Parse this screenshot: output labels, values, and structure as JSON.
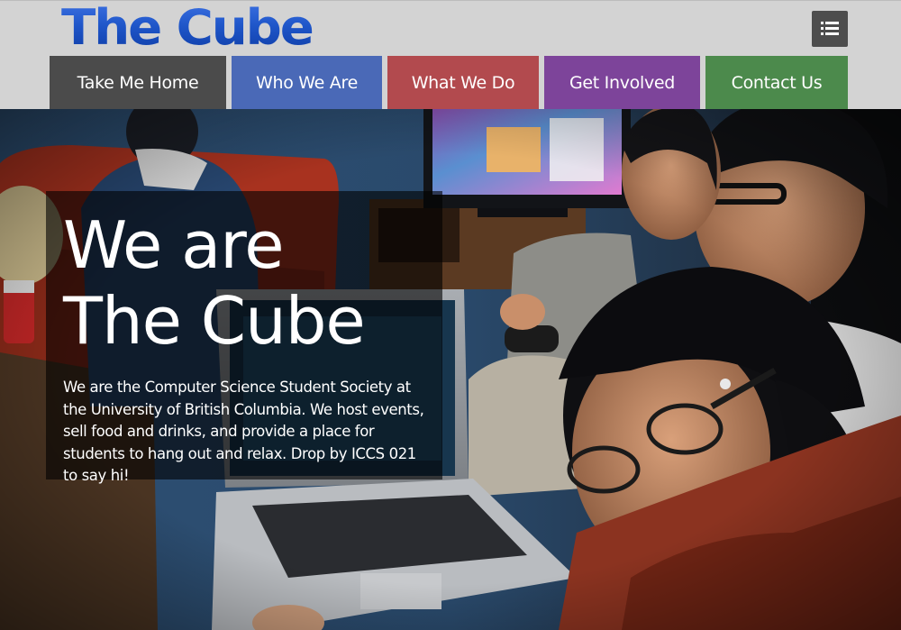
{
  "site": {
    "logo_text": "The Cube",
    "menu_icon": "list-icon"
  },
  "nav": {
    "items": [
      {
        "label": "Take Me Home",
        "color": "#4b4b4b"
      },
      {
        "label": "Who We Are",
        "color": "#4a69b7"
      },
      {
        "label": "What We Do",
        "color": "#b24a4e"
      },
      {
        "label": "Get Involved",
        "color": "#7d449a"
      },
      {
        "label": "Contact Us",
        "color": "#4c8a4c"
      }
    ]
  },
  "hero": {
    "title_line1": "We are",
    "title_line2": "The Cube",
    "description": "We are the Computer Science Student Society at the University of British Columbia. We host events, sell food and drinks, and provide a place for students to hang out and relax. Drop by ICCS 021 to say hi!"
  },
  "colors": {
    "logo_blue": "#1f56c9",
    "header_bg": "#d3d3d3"
  }
}
